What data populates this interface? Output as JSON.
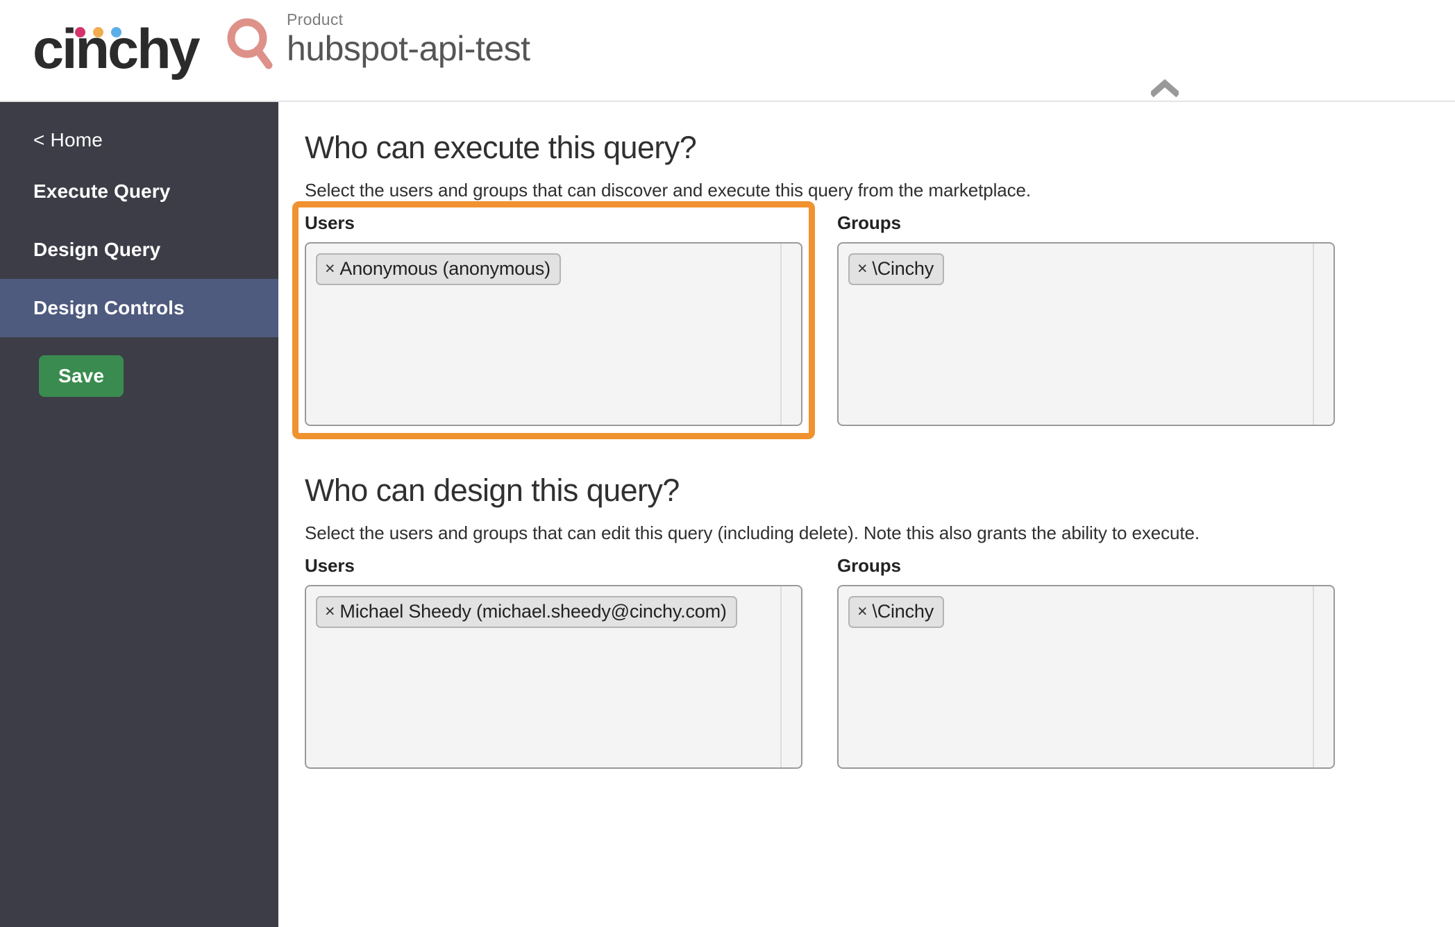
{
  "header": {
    "logo_text": "cinchy",
    "logo_dot_colors": [
      "#d6336c",
      "#f0ad4e",
      "#5bafe8"
    ],
    "search_icon": "search-icon",
    "search_icon_color": "#dd9189",
    "kicker": "Product",
    "title": "hubspot-api-test",
    "collapse_icon": "chevron-up-icon"
  },
  "sidebar": {
    "background": "#3d3d47",
    "active_background": "#4e5a7e",
    "home_label": "< Home",
    "items": [
      {
        "label": "Execute Query",
        "active": false
      },
      {
        "label": "Design Query",
        "active": false
      },
      {
        "label": "Design Controls",
        "active": true
      }
    ],
    "save_label": "Save",
    "save_color": "#3a8b4f"
  },
  "main": {
    "highlight_color": "#f0922f",
    "sections": [
      {
        "title": "Who can execute this query?",
        "description": "Select the users and groups that can discover and execute this query from the marketplace.",
        "users_label": "Users",
        "groups_label": "Groups",
        "users": [
          {
            "remove": "×",
            "label": "Anonymous (anonymous)"
          }
        ],
        "groups": [
          {
            "remove": "×",
            "label": "\\Cinchy"
          }
        ],
        "highlighted_field": "users"
      },
      {
        "title": "Who can design this query?",
        "description": "Select the users and groups that can edit this query (including delete). Note this also grants the ability to execute.",
        "users_label": "Users",
        "groups_label": "Groups",
        "users": [
          {
            "remove": "×",
            "label": "Michael Sheedy (michael.sheedy@cinchy.com)"
          }
        ],
        "groups": [
          {
            "remove": "×",
            "label": "\\Cinchy"
          }
        ],
        "highlighted_field": null
      }
    ]
  }
}
